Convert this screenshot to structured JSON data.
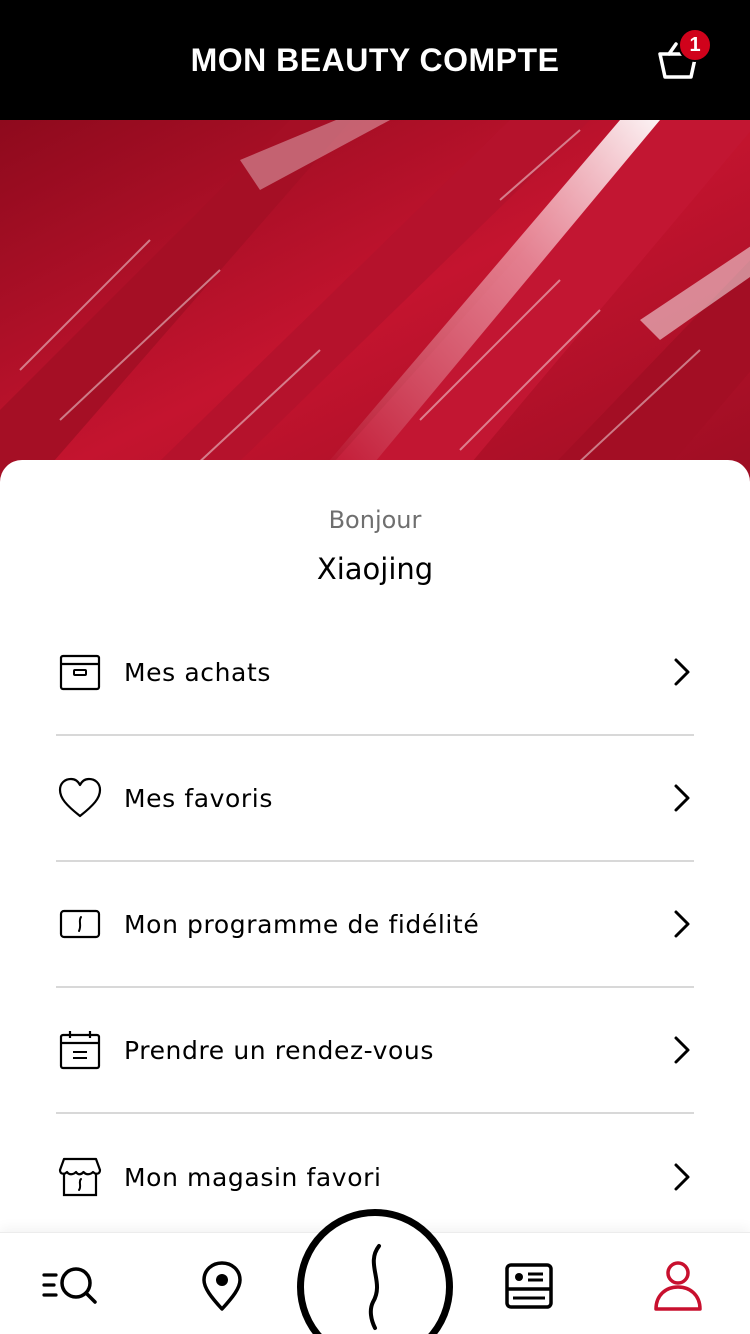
{
  "header": {
    "title": "MON BEAUTY COMPTE",
    "cart_count": "1",
    "cart_icon": "basket-icon",
    "badge_color": "#d0021b"
  },
  "hero": {
    "image": "red-lipstick-texture",
    "accent_color": "#b8122a"
  },
  "profile": {
    "greeting": "Bonjour",
    "name": "Xiaojing"
  },
  "menu": {
    "items": [
      {
        "label": "Mes achats",
        "icon": "box-icon"
      },
      {
        "label": "Mes favoris",
        "icon": "heart-icon"
      },
      {
        "label": "Mon programme de fidélité",
        "icon": "loyalty-card-icon"
      },
      {
        "label": "Prendre un rendez-vous",
        "icon": "calendar-icon"
      },
      {
        "label": "Mon magasin favori",
        "icon": "store-icon"
      }
    ]
  },
  "bottom_nav": {
    "items": [
      {
        "icon": "menu-search-icon"
      },
      {
        "icon": "location-pin-icon"
      },
      {
        "icon": "sephora-logo-icon"
      },
      {
        "icon": "id-card-icon"
      },
      {
        "icon": "account-icon",
        "active": true
      }
    ],
    "active_color": "#c8102e"
  }
}
